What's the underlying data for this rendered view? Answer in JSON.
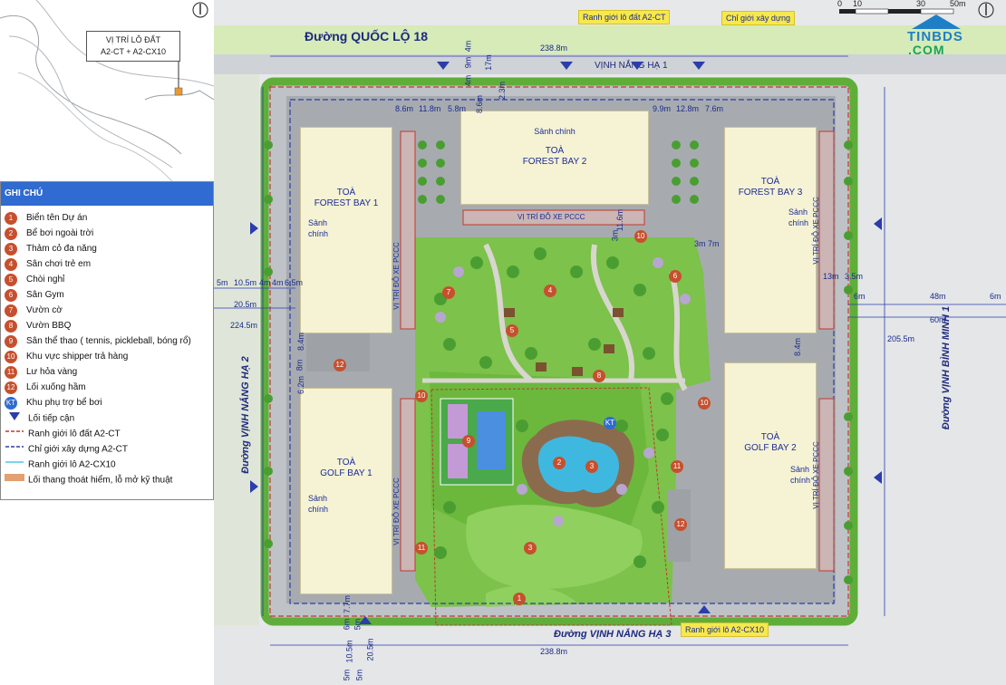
{
  "locator": {
    "label_line1": "VỊ TRÍ LÔ ĐẤT",
    "label_line2": "A2-CT + A2-CX10",
    "compass": "N"
  },
  "legend": {
    "title": "GHI CHÚ",
    "items": [
      {
        "num": "1",
        "text": "Biển tên Dự án"
      },
      {
        "num": "2",
        "text": "Bể bơi ngoài trời"
      },
      {
        "num": "3",
        "text": "Thảm cỏ đa năng"
      },
      {
        "num": "4",
        "text": "Sân chơi trẻ em"
      },
      {
        "num": "5",
        "text": "Chòi nghỉ"
      },
      {
        "num": "6",
        "text": "Sân Gym"
      },
      {
        "num": "7",
        "text": "Vườn cờ"
      },
      {
        "num": "8",
        "text": "Vườn BBQ"
      },
      {
        "num": "9",
        "text": "Sân thể thao ( tennis, pickleball, bóng rổ)"
      },
      {
        "num": "10",
        "text": "Khu vực shipper trả hàng"
      },
      {
        "num": "11",
        "text": "Lư hỏa vàng"
      },
      {
        "num": "12",
        "text": "Lối xuống hầm"
      },
      {
        "num": "KT",
        "text": "Khu phụ trợ bể bơi"
      }
    ],
    "symbols": [
      {
        "kind": "triangle",
        "color": "#2b3dab",
        "text": "Lối tiếp cận"
      },
      {
        "kind": "dash-red",
        "color": "#c0392b",
        "text": "Ranh giới lô đất A2-CT"
      },
      {
        "kind": "dash-blue",
        "color": "#2b3dab",
        "text": "Chỉ giới xây dựng A2-CT"
      },
      {
        "kind": "line-cyan",
        "color": "#7fd3e6",
        "text": "Ranh giới lô A2-CX10"
      },
      {
        "kind": "block-orange",
        "color": "#e3a070",
        "text": "Lối thang thoát hiểm, lỗ mở kỹ thuật"
      }
    ]
  },
  "scale_bar": {
    "ticks": [
      "0",
      "10",
      "30",
      "50m"
    ]
  },
  "watermark": {
    "line1": "TINBDS",
    "line2": ".COM"
  },
  "roads": {
    "north": "Đường QUỐC LỘ 18",
    "north_inner": "VỊNH NẮNG HẠ 1",
    "south": "Đường VỊNH NẮNG HẠ 3",
    "west": "Đường VỊNH NẮNG HẠ 2",
    "east": "Đường VỊNH BÌNH MINH 1"
  },
  "callouts": {
    "plot_boundary": "Ranh giới lô đất A2-CT",
    "build_line": "Chỉ giới xây dựng",
    "cx10_boundary": "Ranh giới lô A2-CX10"
  },
  "towers": {
    "fb1": {
      "line1": "TOÀ",
      "line2": "FOREST BAY 1",
      "lobby1": "Sảnh",
      "lobby2": "chính"
    },
    "fb2": {
      "line1": "TOÀ",
      "line2": "FOREST BAY 2",
      "lobby": "Sảnh chính"
    },
    "fb3": {
      "line1": "TOÀ",
      "line2": "FOREST BAY 3",
      "lobby1": "Sảnh",
      "lobby2": "chính"
    },
    "gb1": {
      "line1": "TOÀ",
      "line2": "GOLF BAY 1",
      "lobby1": "Sảnh",
      "lobby2": "chính"
    },
    "gb2": {
      "line1": "TOÀ",
      "line2": "GOLF BAY 2",
      "lobby1": "Sảnh",
      "lobby2": "chính"
    }
  },
  "fire_lots": {
    "north": "VỊ TRÍ ĐỖ XE PCCC",
    "west_upper": "VỊ TRÍ ĐỖ XE PCCC",
    "west_lower": "VỊ TRÍ ĐỖ XE PCCC",
    "east_upper": "VỊ TRÍ ĐỖ XE PCCC",
    "east_lower": "VỊ TRÍ ĐỖ XE PCCC"
  },
  "dimensions": {
    "top_total": "238.8m",
    "bottom_total": "238.8m",
    "left_total": "224.5m",
    "right_total": "205.5m",
    "top_4m": "4m",
    "top_9m": "9m",
    "top_17m": "17m",
    "top_4m_b": "4m",
    "top_2_3m": "2.3m",
    "top_8_6m_a": "8.6m",
    "top_11_8m": "11.8m",
    "top_5_8m": "5.8m",
    "top_8_6m_b": "8.6m",
    "top_9_9m": "9.9m",
    "top_12_8m": "12.8m",
    "top_7_6m": "7.6m",
    "left_5m": "5m",
    "left_10_5m": "10.5m",
    "left_4m": "4m",
    "left_4m_b": "4m",
    "left_6_5m": "6.5m",
    "left_20_5m": "20.5m",
    "right_13m": "13m",
    "right_3_5m": "3.5m",
    "right_6m_a": "6m",
    "right_48m": "48m",
    "right_6m_b": "6m",
    "right_60m": "60m",
    "mid_11_6m": "11.6m",
    "mid_3m": "3m",
    "mid_3m_b": "3m",
    "mid_7m": "7m",
    "mid_8_4m_a": "8.4m",
    "mid_8m": "8m",
    "mid_6_2m": "6.2m",
    "mid_8_4m_b": "8.4m",
    "bot_7_7m": "7.7m",
    "bot_6m": "6m",
    "bot_5m": "5m",
    "bot_10_5m": "10.5m",
    "bot_5m_b": "5m",
    "bot_20_5m": "20.5m",
    "bot_5m_c": "5m"
  },
  "amenity_pins": [
    "1",
    "2",
    "3",
    "3",
    "4",
    "5",
    "6",
    "7",
    "8",
    "9",
    "10",
    "10",
    "10",
    "11",
    "11",
    "12",
    "12",
    "KT"
  ]
}
